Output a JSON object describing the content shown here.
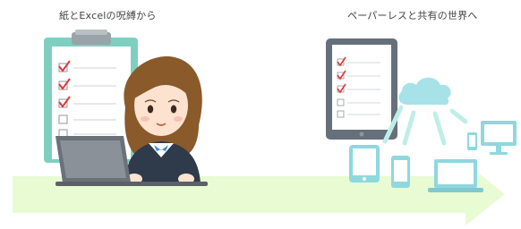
{
  "captions": {
    "left": "紙とExcelの呪縛から",
    "right": "ペーパーレスと共有の世界へ"
  },
  "colors": {
    "arrow": "#e8fbd2",
    "clipboard": "#7fcfc0",
    "device_frame": "#66707a",
    "teal_device": "#8ed8de",
    "check_red": "#e0393a",
    "line_teal": "#bfeee9"
  },
  "icons": {
    "clipboard": "clipboard-icon",
    "woman": "office-worker-illustration",
    "laptop": "laptop-icon",
    "tablet": "tablet-icon",
    "cloud": "cloud-icon",
    "smartphone": "smartphone-icon",
    "monitor": "desktop-monitor-icon"
  }
}
